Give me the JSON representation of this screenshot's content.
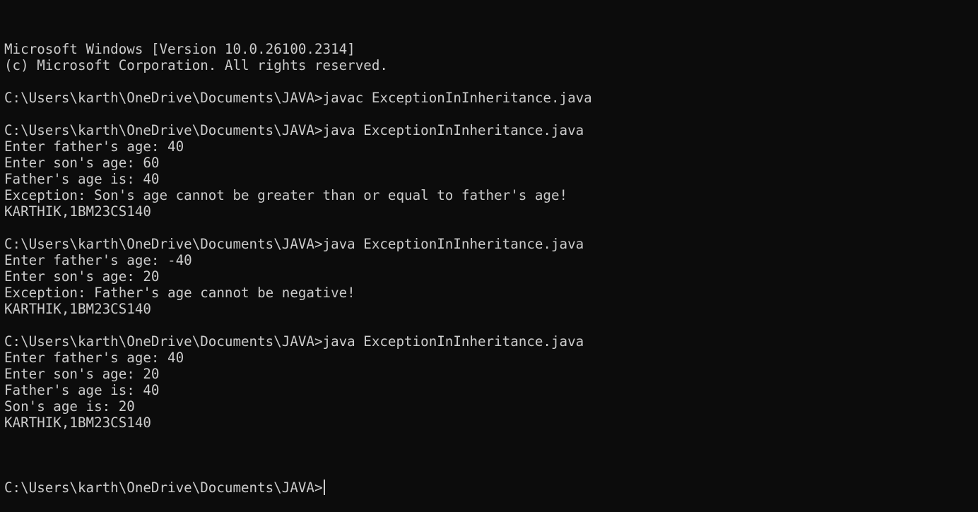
{
  "terminal": {
    "background": "#0c0c0c",
    "foreground": "#cccccc",
    "lines": [
      "Microsoft Windows [Version 10.0.26100.2314]",
      "(c) Microsoft Corporation. All rights reserved.",
      "",
      "C:\\Users\\karth\\OneDrive\\Documents\\JAVA>javac ExceptionInInheritance.java",
      "",
      "C:\\Users\\karth\\OneDrive\\Documents\\JAVA>java ExceptionInInheritance.java",
      "Enter father's age: 40",
      "Enter son's age: 60",
      "Father's age is: 40",
      "Exception: Son's age cannot be greater than or equal to father's age!",
      "KARTHIK,1BM23CS140",
      "",
      "C:\\Users\\karth\\OneDrive\\Documents\\JAVA>java ExceptionInInheritance.java",
      "Enter father's age: -40",
      "Enter son's age: 20",
      "Exception: Father's age cannot be negative!",
      "KARTHIK,1BM23CS140",
      "",
      "C:\\Users\\karth\\OneDrive\\Documents\\JAVA>java ExceptionInInheritance.java",
      "Enter father's age: 40",
      "Enter son's age: 20",
      "Father's age is: 40",
      "Son's age is: 20",
      "KARTHIK,1BM23CS140",
      ""
    ],
    "prompt": "C:\\Users\\karth\\OneDrive\\Documents\\JAVA>"
  }
}
